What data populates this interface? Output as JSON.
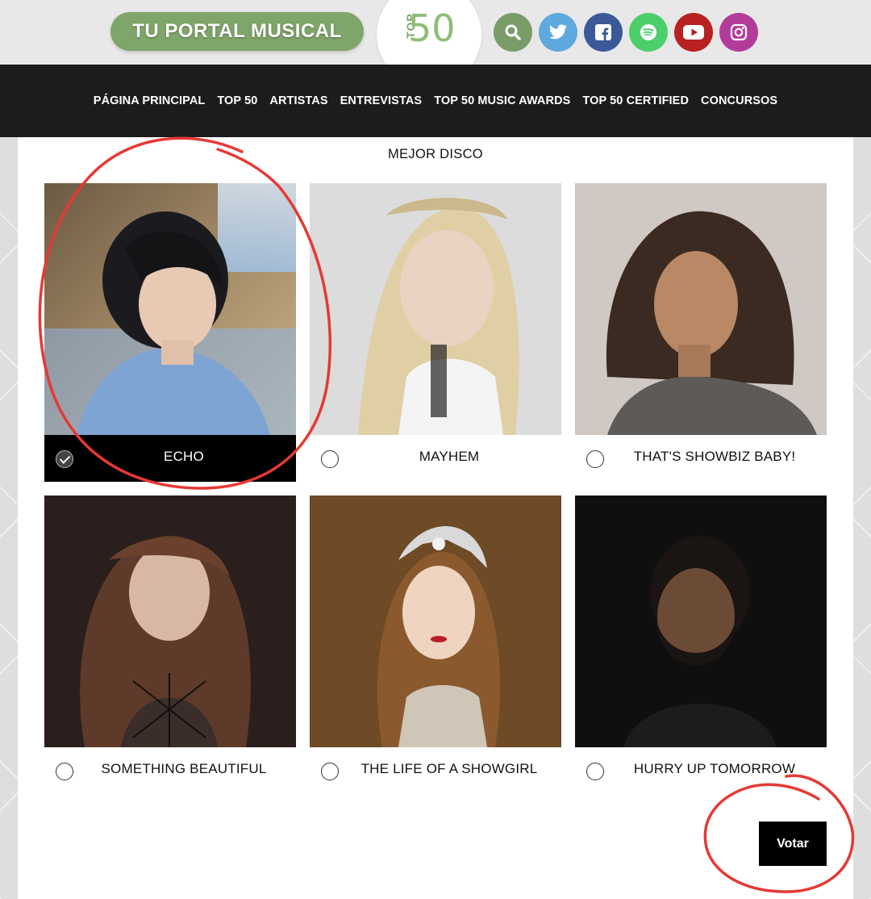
{
  "header": {
    "brand_label": "TU PORTAL MUSICAL",
    "logo_text_top": "TOP",
    "logo_text_num": "50",
    "socials": [
      {
        "name": "search-icon",
        "glyph": "⚲"
      },
      {
        "name": "twitter-icon",
        "glyph": "t"
      },
      {
        "name": "facebook-icon",
        "glyph": "f"
      },
      {
        "name": "spotify-icon",
        "glyph": "≋"
      },
      {
        "name": "youtube-icon",
        "glyph": "▶"
      },
      {
        "name": "instagram-icon",
        "glyph": "◎"
      }
    ]
  },
  "nav": {
    "items": [
      "PÁGINA PRINCIPAL",
      "TOP 50",
      "ARTISTAS",
      "ENTREVISTAS",
      "TOP 50 MUSIC AWARDS",
      "TOP 50 CERTIFIED",
      "CONCURSOS"
    ]
  },
  "poll": {
    "title": "MEJOR DISCO",
    "options": [
      {
        "label": "ECHO",
        "selected": true
      },
      {
        "label": "MAYHEM",
        "selected": false
      },
      {
        "label": "THAT'S SHOWBIZ BABY!",
        "selected": false
      },
      {
        "label": "SOMETHING BEAUTIFUL",
        "selected": false
      },
      {
        "label": "THE LIFE OF A SHOWGIRL",
        "selected": false
      },
      {
        "label": "HURRY UP TOMORROW",
        "selected": false
      }
    ],
    "vote_label": "Votar"
  },
  "colors": {
    "brand_green": "#7fa56a",
    "navbar": "#1c1c1c",
    "annotation_red": "#e53935"
  }
}
